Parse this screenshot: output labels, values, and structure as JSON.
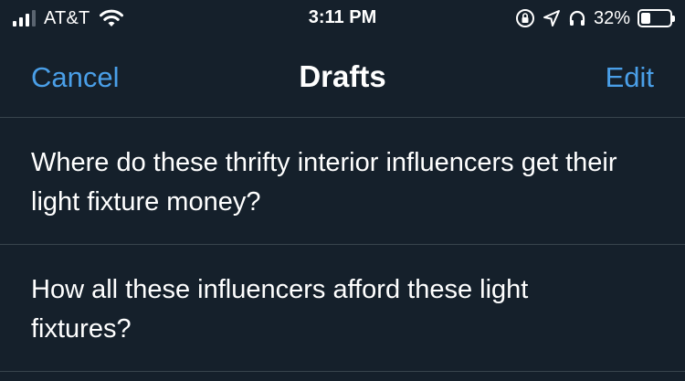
{
  "status_bar": {
    "carrier": "AT&T",
    "time": "3:11 PM",
    "battery_percent": "32%",
    "battery_level": 0.32,
    "signal_bars_active": 3,
    "signal_bars_total": 4,
    "icons": [
      "signal-icon",
      "wifi-icon",
      "orientation-lock-icon",
      "location-arrow-icon",
      "headphones-icon",
      "battery-icon"
    ]
  },
  "nav": {
    "cancel_label": "Cancel",
    "title": "Drafts",
    "edit_label": "Edit"
  },
  "drafts": [
    {
      "text": "Where do these thrifty interior influencers get their light fixture money?"
    },
    {
      "text": "How all these influencers afford these light fixtures?"
    }
  ],
  "colors": {
    "background": "#15202b",
    "accent": "#4a9fe8",
    "divider": "#38444d",
    "text": "#ffffff"
  }
}
